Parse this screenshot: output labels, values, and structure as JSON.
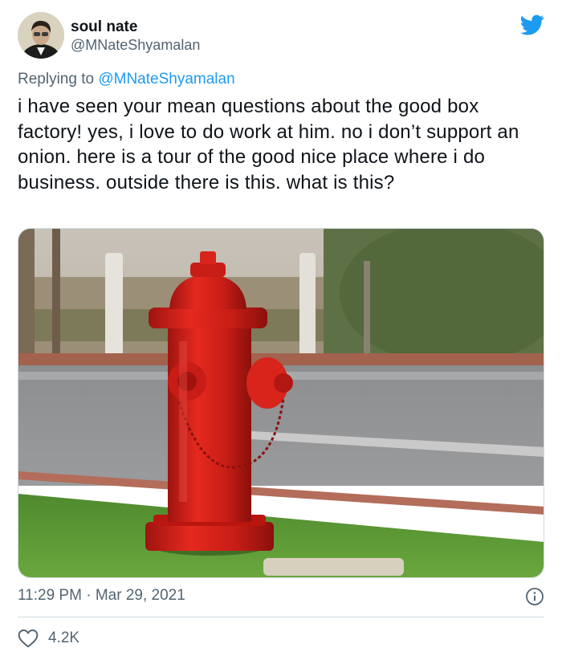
{
  "author": {
    "display_name": "soul nate",
    "handle": "@MNateShyamalan"
  },
  "reply": {
    "prefix": "Replying to",
    "mention": "@MNateShyamalan"
  },
  "tweet": {
    "text": "i have seen your mean questions about the good box factory! yes, i love to do work at him. no i don’t support an onion. here is a tour of the good nice place where i do business. outside there is this. what is this?"
  },
  "meta": {
    "time": "11:29 PM",
    "separator": "·",
    "date": "Mar 29, 2021"
  },
  "engagement": {
    "likes": "4.2K"
  },
  "icons": {
    "brand": "twitter-bird-icon",
    "info": "info-icon",
    "like": "heart-icon"
  },
  "colors": {
    "accent": "#1d9bf0",
    "text": "#0f1419",
    "secondary": "#536471",
    "border": "#cfd9de",
    "hydrant": "#d81f1a"
  }
}
